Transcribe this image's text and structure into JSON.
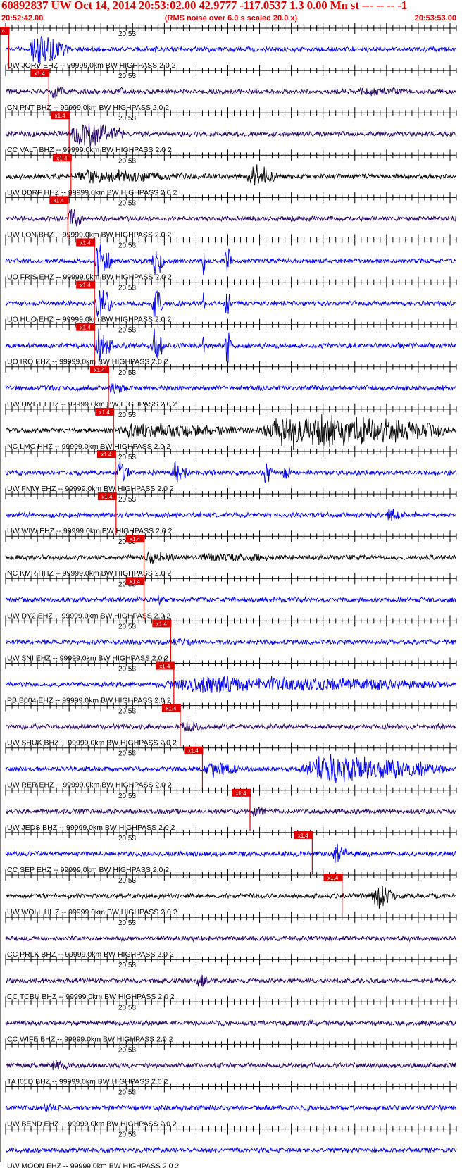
{
  "header": {
    "title": "60892837 UW Oct 14, 2014 20:53:02.00   42.9777 -117.0537  1.3 0.00 Mn st --- -- --  -1",
    "start_time": "20:52:42.00",
    "note": "(RMS noise over 6.0 s scaled 20.0 x)",
    "end_time": "20:53:53.00"
  },
  "chart_data": {
    "type": "line",
    "title": "60892837 UW Oct 14, 2014 20:53:02.00   42.9777 -117.0537  1.3 0.00 Mn st --- -- --  -1",
    "x_start": "20:52:42.00",
    "x_end": "20:53:53.00",
    "minute_tick_label": "20:53",
    "pick_label": "x1.4",
    "tick_interval_s": 1,
    "colors": {
      "red": "#e00000",
      "blue": "#0000ee",
      "navy": "#220066",
      "black": "#000000"
    },
    "series": [
      {
        "name": "UW JORV EHZ -- 99999.0km BW  HIGHPASS  2.0  2",
        "color": "#0000ee",
        "pick_s": 0.5,
        "events": [
          {
            "start": 3.5,
            "dur": 6.5,
            "amp": 28
          }
        ]
      },
      {
        "name": "CN PNT BHZ -- 99999.0km BW  HIGHPASS  2.0  2",
        "color": "#220066",
        "pick_s": 6.8,
        "events": [
          {
            "start": 7.0,
            "dur": 2.5,
            "amp": 10
          },
          {
            "start": 18.0,
            "dur": 0.4,
            "amp": 12
          },
          {
            "start": 55.0,
            "dur": 8.0,
            "amp": 4
          }
        ]
      },
      {
        "name": "CC VALT BHZ -- 99999.0km BW  HIGHPASS  2.0  2",
        "color": "#220066",
        "pick_s": 10.0,
        "events": [
          {
            "start": 10.0,
            "dur": 9.0,
            "amp": 22
          }
        ]
      },
      {
        "name": "UW DDRF HHZ -- 99999.0km BW  HIGHPASS  2.0  2",
        "color": "#000000",
        "pick_s": 10.3,
        "events": [
          {
            "start": 10.3,
            "dur": 18.0,
            "amp": 9
          },
          {
            "start": 38.0,
            "dur": 5.0,
            "amp": 22
          }
        ]
      },
      {
        "name": "UW LON BHZ -- 99999.0km BW  HIGHPASS  2.0  2",
        "color": "#220066",
        "pick_s": 9.8,
        "events": [
          {
            "start": 9.8,
            "dur": 2.5,
            "amp": 16
          }
        ]
      },
      {
        "name": "UO FRIS EHZ -- 99999.0km BW  HIGHPASS  2.0  2",
        "color": "#0000ee",
        "pick_s": 14.0,
        "events": [
          {
            "start": 14.0,
            "dur": 3.0,
            "amp": 30
          },
          {
            "start": 23.0,
            "dur": 2.0,
            "amp": 30
          },
          {
            "start": 31.0,
            "dur": 0.4,
            "amp": 30
          },
          {
            "start": 34.5,
            "dur": 1.2,
            "amp": 30
          }
        ]
      },
      {
        "name": "UO HUO EHZ -- 99999.0km BW  HIGHPASS  2.0  2",
        "color": "#0000ee",
        "pick_s": 14.0,
        "events": [
          {
            "start": 14.0,
            "dur": 3.0,
            "amp": 30
          },
          {
            "start": 23.0,
            "dur": 2.0,
            "amp": 30
          },
          {
            "start": 31.0,
            "dur": 0.4,
            "amp": 30
          },
          {
            "start": 34.5,
            "dur": 1.2,
            "amp": 30
          }
        ]
      },
      {
        "name": "UO IRO EHZ -- 99999.0km BW  HIGHPASS  2.0  2",
        "color": "#0000ee",
        "pick_s": 14.0,
        "events": [
          {
            "start": 14.0,
            "dur": 3.0,
            "amp": 30
          },
          {
            "start": 23.0,
            "dur": 2.0,
            "amp": 30
          },
          {
            "start": 31.0,
            "dur": 0.4,
            "amp": 30
          },
          {
            "start": 34.5,
            "dur": 1.2,
            "amp": 30
          }
        ]
      },
      {
        "name": "UW HMET EHZ -- 99999.0km BW  HIGHPASS  2.0  2",
        "color": "#0000ee",
        "pick_s": 16.2,
        "events": [
          {
            "start": 16.2,
            "dur": 3.0,
            "amp": 8
          }
        ]
      },
      {
        "name": "NC LMC HHZ -- 99999.0km BW  HIGHPASS  2.0  2",
        "color": "#000000",
        "pick_s": 17.0,
        "events": [
          {
            "start": 17.0,
            "dur": 22.0,
            "amp": 10
          },
          {
            "start": 39.5,
            "dur": 31.0,
            "amp": 30
          }
        ]
      },
      {
        "name": "UW FMW EHZ -- 99999.0km BW  HIGHPASS  2.0  2",
        "color": "#0000ee",
        "pick_s": 17.3,
        "events": [
          {
            "start": 17.5,
            "dur": 2.0,
            "amp": 22
          },
          {
            "start": 26.0,
            "dur": 3.0,
            "amp": 16
          },
          {
            "start": 40.5,
            "dur": 2.0,
            "amp": 18
          },
          {
            "start": 43.5,
            "dur": 1.5,
            "amp": 12
          }
        ]
      },
      {
        "name": "UW WIW EHZ -- 99999.0km BW  HIGHPASS  2.0  2",
        "color": "#0000ee",
        "pick_s": 17.4,
        "events": [
          {
            "start": 60.0,
            "dur": 2.5,
            "amp": 10
          }
        ]
      },
      {
        "name": "NC KMR HHZ -- 99999.0km BW  HIGHPASS  2.0  2",
        "color": "#000000",
        "pick_s": 21.8,
        "events": [
          {
            "start": 21.8,
            "dur": 5.0,
            "amp": 8
          },
          {
            "start": 30.0,
            "dur": 13.0,
            "amp": 5
          }
        ]
      },
      {
        "name": "UW DY2 EHZ -- 99999.0km BW  HIGHPASS  2.0  2",
        "color": "#0000ee",
        "pick_s": 21.8,
        "events": [
          {
            "start": 12.0,
            "dur": 0.3,
            "amp": 10
          },
          {
            "start": 24.0,
            "dur": 0.4,
            "amp": 12
          },
          {
            "start": 36.0,
            "dur": 0.3,
            "amp": 10
          },
          {
            "start": 47.0,
            "dur": 0.3,
            "amp": 8
          }
        ]
      },
      {
        "name": "UW SNI EHZ -- 99999.0km BW  HIGHPASS  2.0  2",
        "color": "#0000ee",
        "pick_s": 26.0,
        "events": [
          {
            "start": 26.0,
            "dur": 5.0,
            "amp": 5
          }
        ]
      },
      {
        "name": "PB B004 EHZ -- 99999.0km BW  HIGHPASS  2.0  2",
        "color": "#0000ee",
        "pick_s": 26.5,
        "events": [
          {
            "start": 24.0,
            "dur": 46.0,
            "amp": 12
          }
        ]
      },
      {
        "name": "UW SHUK BHZ -- 99999.0km BW  HIGHPASS  2.0  2",
        "color": "#220066",
        "pick_s": 27.5,
        "events": [
          {
            "start": 27.5,
            "dur": 4.0,
            "amp": 8
          }
        ]
      },
      {
        "name": "UW RER EHZ -- 99999.0km BW  HIGHPASS  2.0  2",
        "color": "#0000ee",
        "pick_s": 31.0,
        "events": [
          {
            "start": 31.0,
            "dur": 6.0,
            "amp": 12
          },
          {
            "start": 46.0,
            "dur": 24.0,
            "amp": 22
          }
        ]
      },
      {
        "name": "UW JEDS BHZ -- 99999.0km BW  HIGHPASS  2.0  2",
        "color": "#220066",
        "pick_s": 38.5,
        "events": [
          {
            "start": 38.5,
            "dur": 3.0,
            "amp": 8
          }
        ]
      },
      {
        "name": "CC SEP EHZ -- 99999.0km BW  HIGHPASS  2.0  2",
        "color": "#0000ee",
        "pick_s": 48.3,
        "events": [
          {
            "start": 51.5,
            "dur": 2.5,
            "amp": 18
          }
        ]
      },
      {
        "name": "UW WOLL HHZ -- 99999.0km BW  HIGHPASS  2.0  2",
        "color": "#000000",
        "pick_s": 53.0,
        "events": [
          {
            "start": 57.5,
            "dur": 4.0,
            "amp": 20
          }
        ]
      },
      {
        "name": "CC PRLK BHZ -- 99999.0km BW  HIGHPASS  2.0  2",
        "color": "#220066",
        "pick_s": null,
        "events": []
      },
      {
        "name": "CC TCBU BHZ -- 99999.0km BW  HIGHPASS  2.0  2",
        "color": "#220066",
        "pick_s": null,
        "events": [
          {
            "start": 30.0,
            "dur": 2.0,
            "amp": 12
          }
        ]
      },
      {
        "name": "CC WIFE BHZ -- 99999.0km BW  HIGHPASS  2.0  2",
        "color": "#220066",
        "pick_s": null,
        "events": []
      },
      {
        "name": "TA I05D BHZ -- 99999.0km BW  HIGHPASS  2.0  2",
        "color": "#220066",
        "pick_s": null,
        "events": [
          {
            "start": 7.0,
            "dur": 3.0,
            "amp": 6
          }
        ]
      },
      {
        "name": "UW BEND EHZ -- 99999.0km BW  HIGHPASS  2.0  2",
        "color": "#0000ee",
        "pick_s": null,
        "events": [
          {
            "start": 6.0,
            "dur": 2.0,
            "amp": 8
          }
        ]
      },
      {
        "name": "UW MOON EHZ -- 99999.0km BW  HIGHPASS  2.0  2",
        "color": "#0000ee",
        "pick_s": null,
        "events": []
      }
    ]
  }
}
